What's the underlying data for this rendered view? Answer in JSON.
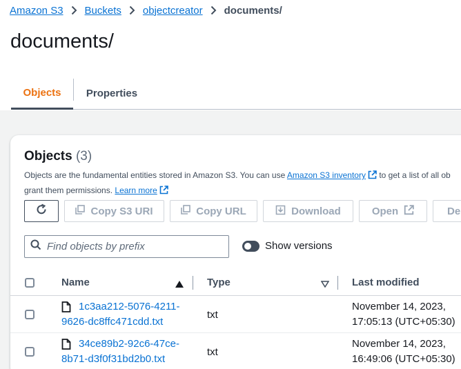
{
  "breadcrumb": {
    "items": [
      "Amazon S3",
      "Buckets",
      "objectcreator"
    ],
    "current": "documents/"
  },
  "page_title": "documents/",
  "tabs": [
    {
      "label": "Objects",
      "active": true
    },
    {
      "label": "Properties",
      "active": false
    }
  ],
  "objects_panel": {
    "title": "Objects",
    "count": "(3)",
    "description_prefix": "Objects are the fundamental entities stored in Amazon S3. You can use",
    "inventory_link": "Amazon S3 inventory",
    "description_middle": "to get a list of all ob",
    "description_line2": "grant them permissions.",
    "learn_more": "Learn more"
  },
  "toolbar": {
    "copy_s3_uri": "Copy S3 URI",
    "copy_url": "Copy URL",
    "download": "Download",
    "open": "Open",
    "delete_partial": "Del"
  },
  "search": {
    "placeholder": "Find objects by prefix"
  },
  "show_versions": {
    "label": "Show versions",
    "on": false
  },
  "table": {
    "columns": [
      "Name",
      "Type",
      "Last modified"
    ],
    "rows": [
      {
        "name_line1": "1c3aa212-5076-4211-",
        "name_line2": "9626-dc8ffc471cdd.txt",
        "type": "txt",
        "modified_line1": "November 14, 2023,",
        "modified_line2": "17:05:13 (UTC+05:30)"
      },
      {
        "name_line1": "34ce89b2-92c6-47ce-",
        "name_line2": "8b71-d3f0f31bd2b0.txt",
        "type": "txt",
        "modified_line1": "November 14, 2023,",
        "modified_line2": "16:49:06 (UTC+05:30)"
      }
    ]
  },
  "colors": {
    "accent": "#ec7211",
    "link": "#0972d3",
    "text": "#16191f"
  }
}
